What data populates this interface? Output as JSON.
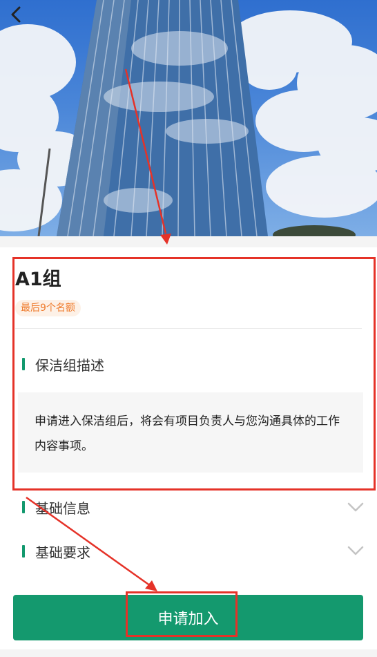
{
  "header": {
    "back_icon": "chevron-left-icon"
  },
  "group": {
    "title": "A1组",
    "quota_badge": "最后9个名额"
  },
  "sections": {
    "description": {
      "title": "保洁组描述",
      "text": "申请进入保洁组后，将会有项目负责人与您沟通具体的工作内容事项。"
    },
    "basic_info": {
      "title": "基础信息",
      "icon": "chevron-down-icon"
    },
    "basic_requirements": {
      "title": "基础要求",
      "icon": "chevron-down-icon"
    }
  },
  "apply_button": {
    "label": "申请加入"
  },
  "colors": {
    "accent": "#14996e",
    "badge_text": "#ef7b2c",
    "annotation": "#e53228"
  }
}
